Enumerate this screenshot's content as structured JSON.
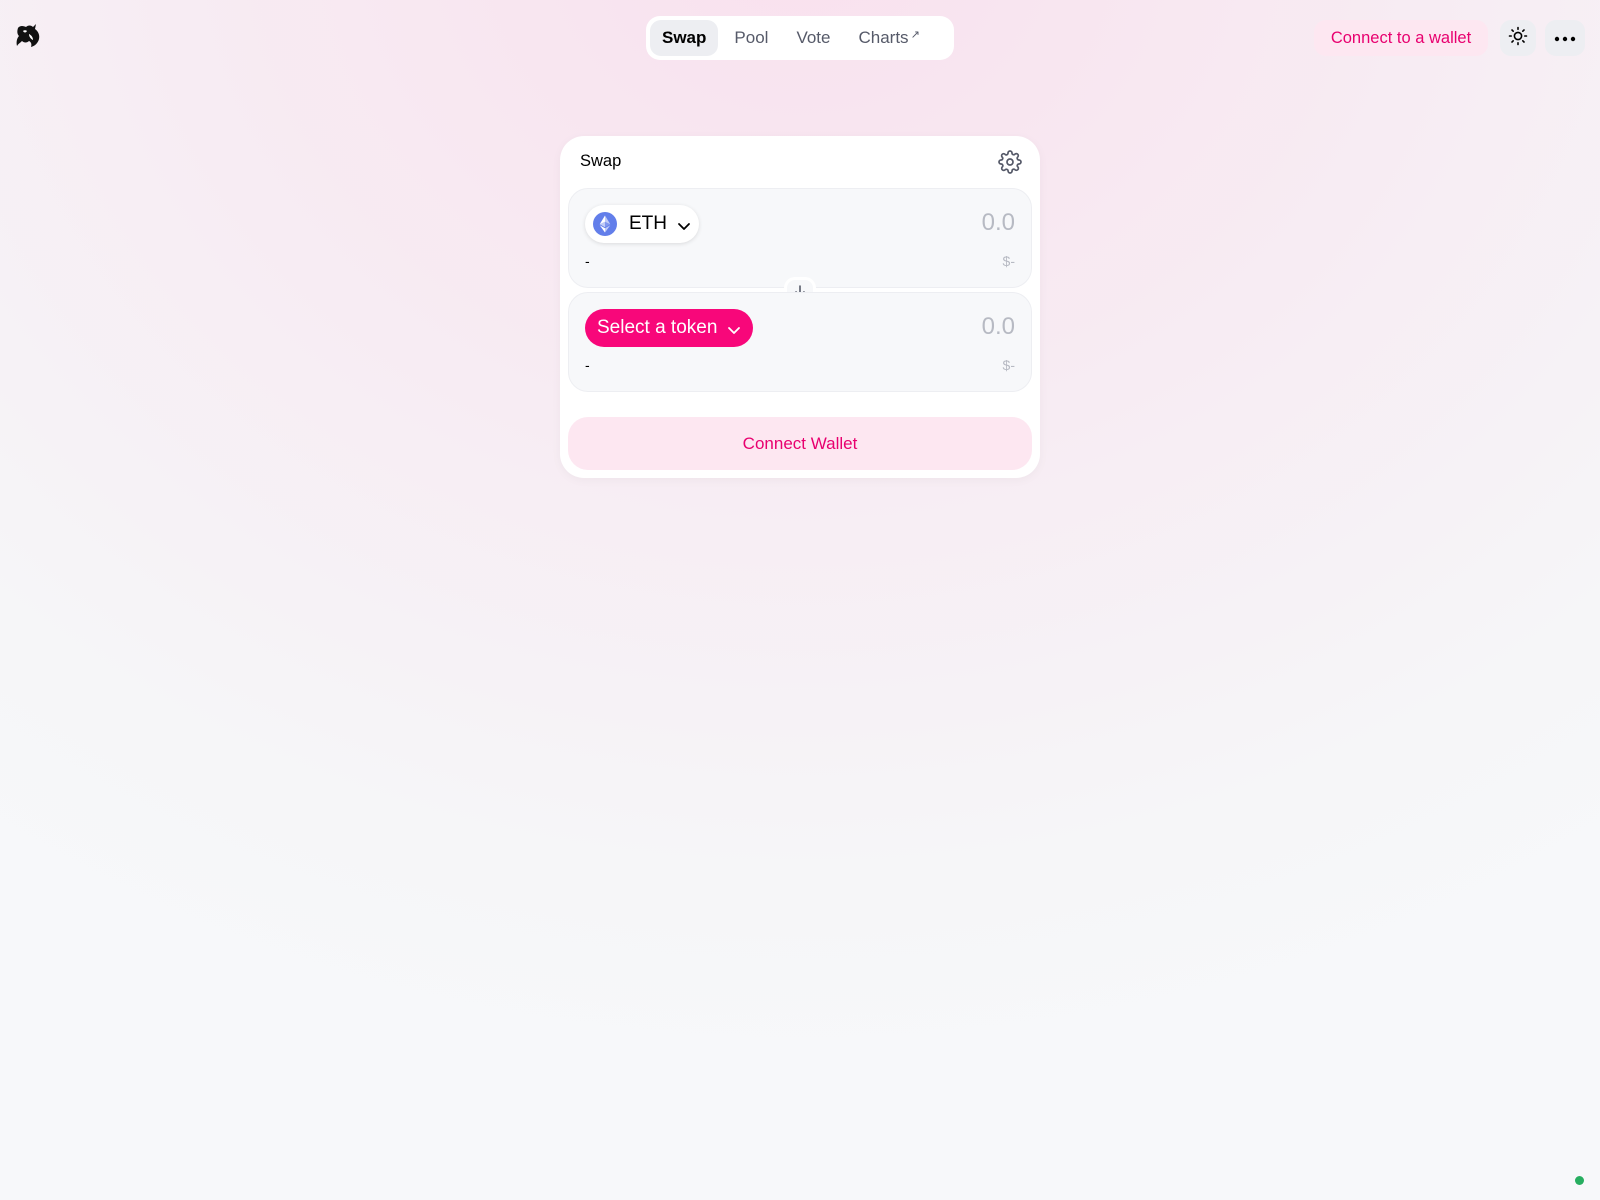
{
  "header": {
    "logo_icon": "unicorn-logo-icon",
    "nav_tabs": [
      {
        "label": "Swap",
        "active": true
      },
      {
        "label": "Pool",
        "active": false
      },
      {
        "label": "Vote",
        "active": false
      },
      {
        "label": "Charts",
        "active": false,
        "external_marker": "↗"
      }
    ],
    "connect_label": "Connect to a wallet",
    "theme_icon": "sun-icon",
    "more_icon": "ellipsis-icon"
  },
  "swap": {
    "title": "Swap",
    "settings_icon": "gear-icon",
    "input": {
      "token_symbol": "ETH",
      "token_icon": "eth-icon",
      "amount_placeholder": "0.0",
      "balance": "-",
      "fiat_value": "$-"
    },
    "switch_icon": "arrow-down-icon",
    "output": {
      "token_label": "Select a token",
      "amount_placeholder": "0.0",
      "balance": "-",
      "fiat_value": "$-"
    },
    "connect_label": "Connect Wallet"
  },
  "colors": {
    "accent": "#e8006f",
    "accent_bg": "#fde7f1",
    "select_token_bg": "#f8077a",
    "status_dot": "#27ae60"
  }
}
